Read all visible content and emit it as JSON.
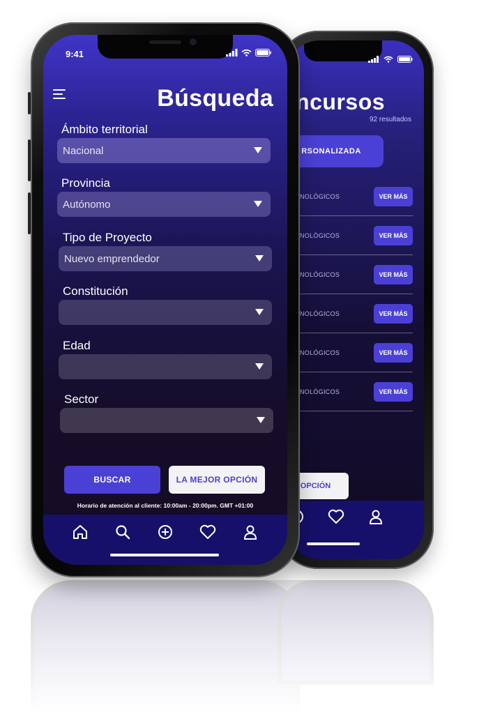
{
  "front": {
    "status_time": "9:41",
    "title": "Búsqueda",
    "fields": [
      {
        "label": "Ámbito territorial",
        "value": "Nacional"
      },
      {
        "label": "Provincia",
        "value": "Autónomo"
      },
      {
        "label": "Tipo de Proyecto",
        "value": "Nuevo emprendedor"
      },
      {
        "label": "Constitución",
        "value": ""
      },
      {
        "label": "Edad",
        "value": ""
      },
      {
        "label": "Sector",
        "value": ""
      }
    ],
    "buscar_label": "BUSCAR",
    "mejor_label": "LA MEJOR OPCIÓN",
    "hours": "Horario de atención al cliente: 10:00am - 20:00pm. GMT +01:00",
    "nav": [
      "home-icon",
      "search-icon",
      "add-icon",
      "heart-icon",
      "user-icon"
    ]
  },
  "back": {
    "title": "oncursos",
    "subtitle": "92 resultados",
    "pill_label": "RSONALIZADA",
    "rows": [
      {
        "category": "NOLÓGICOS",
        "button": "VER MÁS"
      },
      {
        "category": "NOLÓGICOS",
        "button": "VER MÁS"
      },
      {
        "category": "NOLÓGICOS",
        "button": "VER MÁS"
      },
      {
        "category": "NOLÓGICOS",
        "button": "VER MÁS"
      },
      {
        "category": "NOLÓGICOS",
        "button": "VER MÁS"
      },
      {
        "category": "NOLÓGICOS",
        "button": "VER MÁS"
      }
    ],
    "best_label": "R OPCIÓN"
  },
  "colors": {
    "accent": "#4b40d6",
    "nav_bg": "#17106a"
  }
}
